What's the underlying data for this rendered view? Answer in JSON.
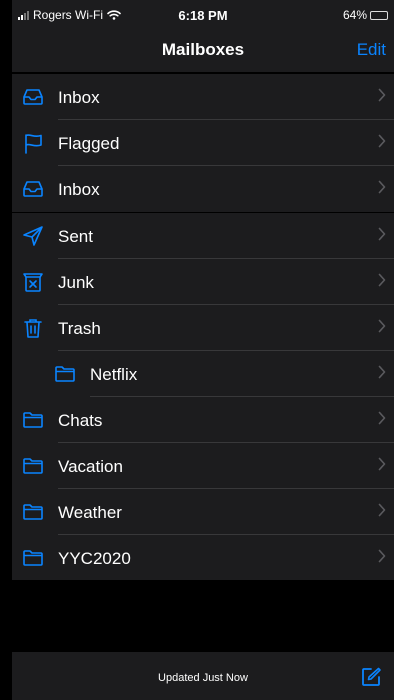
{
  "status_bar": {
    "carrier": "Rogers Wi-Fi",
    "time": "6:18 PM",
    "battery": "64%",
    "battery_level": 0.64
  },
  "nav": {
    "title": "Mailboxes",
    "edit_label": "Edit"
  },
  "mailboxes": [
    {
      "label": "Inbox",
      "icon": "inbox-tray-icon"
    },
    {
      "label": "Flagged",
      "icon": "flag-icon"
    },
    {
      "label": "Inbox",
      "icon": "inbox-tray-icon"
    },
    {
      "label": "Sent",
      "icon": "paper-plane-icon"
    },
    {
      "label": "Junk",
      "icon": "junk-bin-icon"
    },
    {
      "label": "Trash",
      "icon": "trash-icon"
    },
    {
      "label": "Netflix",
      "icon": "folder-icon"
    },
    {
      "label": "Chats",
      "icon": "folder-icon"
    },
    {
      "label": "Vacation",
      "icon": "folder-icon"
    },
    {
      "label": "Weather",
      "icon": "folder-icon"
    },
    {
      "label": "YYC2020",
      "icon": "folder-icon"
    }
  ],
  "toolbar": {
    "status": "Updated Just Now",
    "compose_icon": "compose-icon"
  },
  "colors": {
    "accent": "#0a84ff",
    "background": "#000000",
    "surface": "#1c1c1e",
    "separator": "#38383a"
  }
}
